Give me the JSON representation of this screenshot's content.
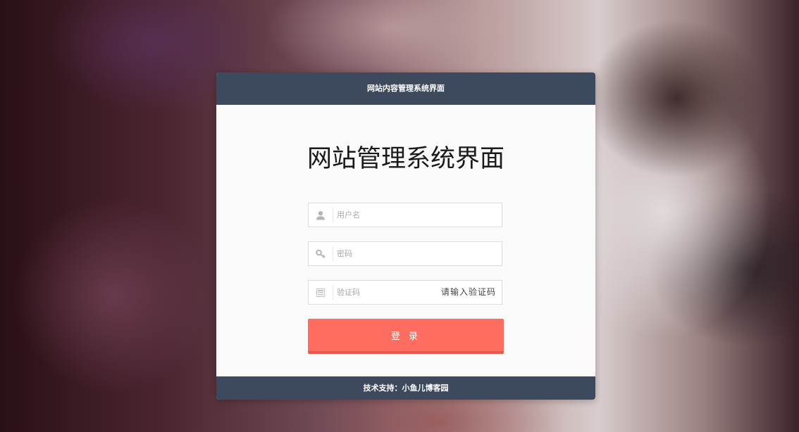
{
  "panel": {
    "header_title": "网站内容管理系统界面",
    "main_title": "网站管理系统界面",
    "footer_text": "技术支持：小鱼儿博客园"
  },
  "form": {
    "username": {
      "placeholder": "用户名",
      "value": "",
      "icon": "user-icon"
    },
    "password": {
      "placeholder": "密码",
      "value": "",
      "icon": "key-icon"
    },
    "captcha": {
      "placeholder": "验证码",
      "value": "",
      "icon": "captcha-icon",
      "captcha_label": "请输入验证码"
    },
    "login_label": "登 录"
  },
  "colors": {
    "header_bg": "#3d4a5d",
    "login_button": "#ff6c60",
    "panel_bg": "#fafafa"
  }
}
